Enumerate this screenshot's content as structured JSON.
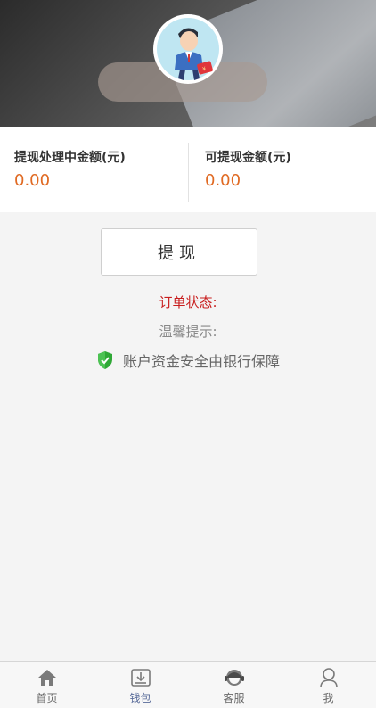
{
  "header": {
    "avatar_icon": "user-avatar-icon"
  },
  "amounts": {
    "processing_label": "提现处理中金额(元)",
    "processing_value": "0.00",
    "available_label": "可提现金额(元)",
    "available_value": "0.00",
    "value_color": "#e06a23"
  },
  "actions": {
    "withdraw_label": "提现"
  },
  "info": {
    "order_status_label": "订单状态:",
    "tips_label": "温馨提示:",
    "security_text": "账户资金安全由银行保障",
    "security_icon": "shield-icon",
    "order_status_color": "#c81e1e",
    "shield_color": "#2fa836"
  },
  "tabbar": {
    "items": [
      {
        "label": "首页",
        "icon": "home-icon"
      },
      {
        "label": "钱包",
        "icon": "wallet-download-icon",
        "active": true
      },
      {
        "label": "客服",
        "icon": "customer-service-icon"
      },
      {
        "label": "我",
        "icon": "user-icon"
      }
    ]
  }
}
